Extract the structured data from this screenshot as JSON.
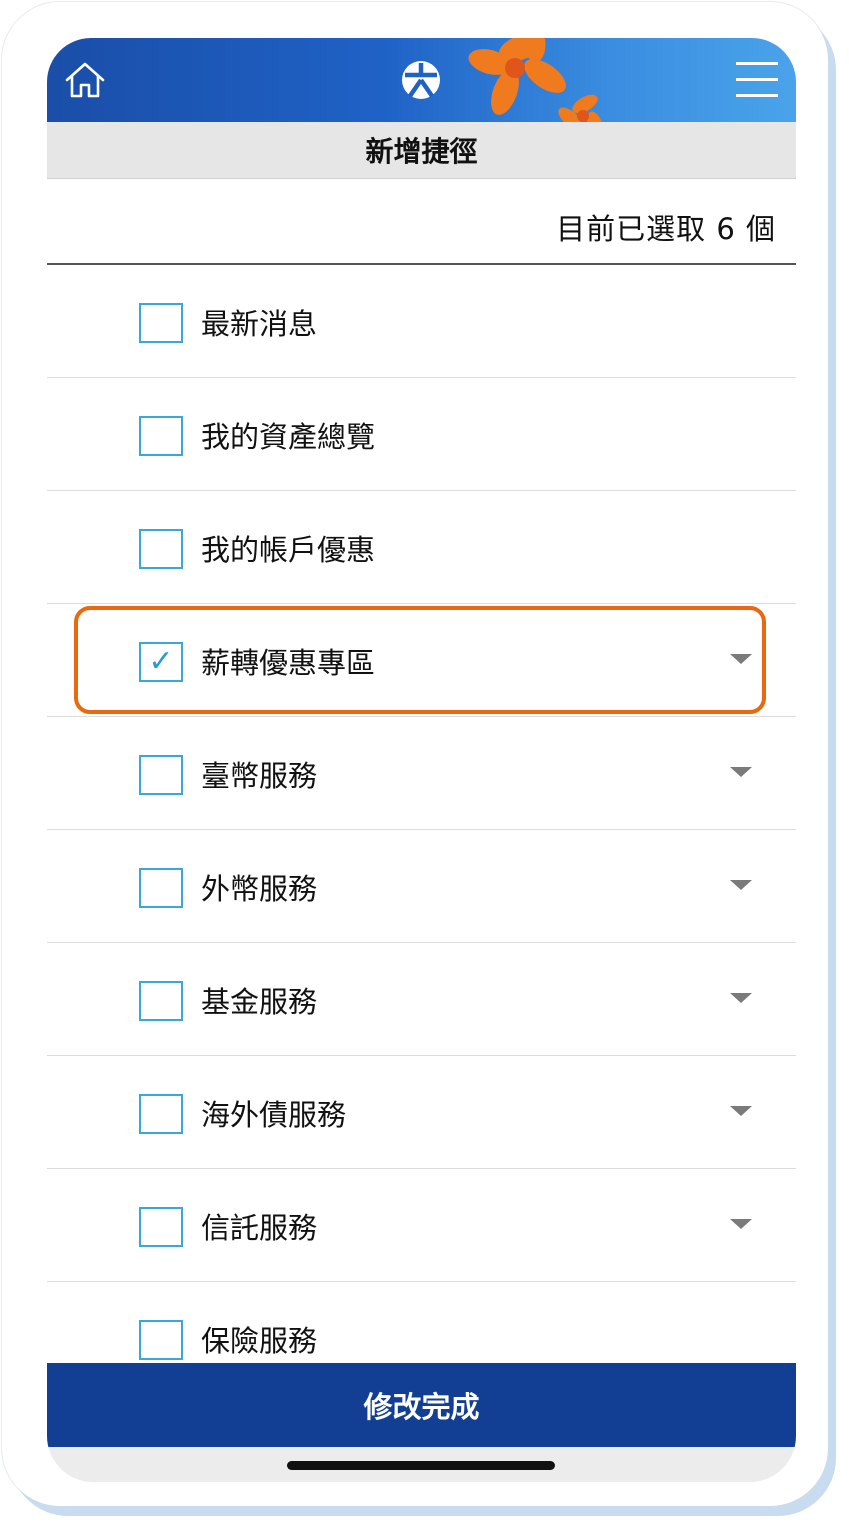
{
  "header": {
    "title": "新增捷徑",
    "home_icon": "home-icon",
    "menu_icon": "hamburger-menu-icon",
    "logo_icon": "bank-logo-icon"
  },
  "selection": {
    "count_text": "目前已選取 6 個"
  },
  "items": [
    {
      "label": "最新消息",
      "checked": false,
      "expandable": false
    },
    {
      "label": "我的資產總覽",
      "checked": false,
      "expandable": false
    },
    {
      "label": "我的帳戶優惠",
      "checked": false,
      "expandable": false
    },
    {
      "label": "薪轉優惠專區",
      "checked": true,
      "expandable": true,
      "highlighted": true
    },
    {
      "label": "臺幣服務",
      "checked": false,
      "expandable": true
    },
    {
      "label": "外幣服務",
      "checked": false,
      "expandable": true
    },
    {
      "label": "基金服務",
      "checked": false,
      "expandable": true
    },
    {
      "label": "海外債服務",
      "checked": false,
      "expandable": true
    },
    {
      "label": "信託服務",
      "checked": false,
      "expandable": true
    },
    {
      "label": "保險服務",
      "checked": false,
      "expandable": false
    }
  ],
  "check_glyph": "✓",
  "footer": {
    "done_label": "修改完成"
  },
  "colors": {
    "header_blue": "#1f62c6",
    "checkbox_border": "#3aa6dc",
    "highlight_orange": "#e8690f",
    "button_navy": "#123f93",
    "flower_orange": "#f07a1e"
  }
}
